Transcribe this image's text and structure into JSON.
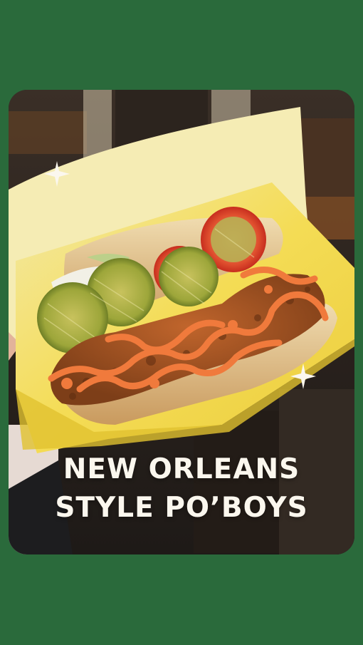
{
  "headline": {
    "line1": "NEW ORLEANS",
    "line2": "STYLE PO’BOYS"
  },
  "colors": {
    "background_green": "#2a6a3b",
    "headline_text": "#fbf7ee",
    "paper_yellow": "#f2d94a",
    "sauce_orange": "#f07a3c"
  },
  "icons": [
    "sparkle-icon",
    "sparkle-icon"
  ]
}
